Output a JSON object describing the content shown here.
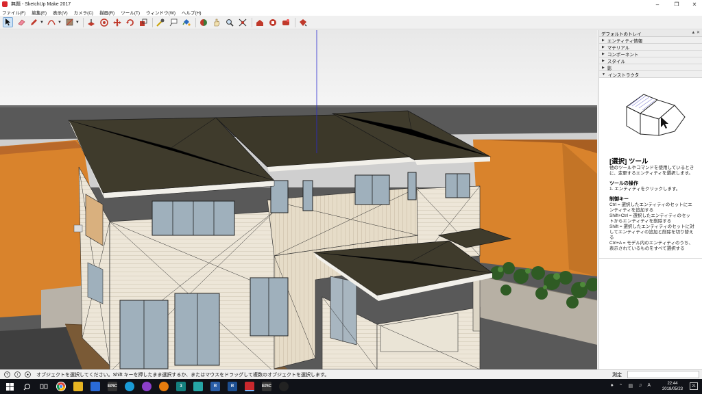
{
  "window": {
    "title": "無題 - SketchUp Make 2017"
  },
  "menu": [
    "ファイル(F)",
    "編集(E)",
    "表示(V)",
    "カメラ(C)",
    "描画(R)",
    "ツール(T)",
    "ウィンドウ(W)",
    "ヘルプ(H)"
  ],
  "tray": {
    "title": "デフォルトのトレイ",
    "panels": [
      "エンティティ情報",
      "マテリアル",
      "コンポーネント",
      "スタイル",
      "影",
      "インストラクタ"
    ],
    "instructor": {
      "tool_title": "[選択] ツール",
      "intro": "他のツールやコマンドを使用しているときに、変更するエンティティを選択します。",
      "ops_heading": "ツールの操作",
      "ops_step": "1. エンティティをクリックします。",
      "mod_heading": "制御キー",
      "mods": [
        "Ctrl = 選択したエンティティのセットにエンティティを追加する",
        "Shift+Ctrl = 選択したエンティティのセットからエンティティを削除する",
        "Shift = 選択したエンティティのセットに対してエンティティの追加と削除を切り替える",
        "Ctrl+A = モデル内のエンティティのうち、表示されているものをすべて選択する"
      ]
    }
  },
  "status": {
    "message": "オブジェクトを選択してください。Shift キーを押したまま選択するか、またはマウスをドラッグして複数のオブジェクトを選択します。",
    "measure_label": "測定",
    "measure_value": ""
  },
  "taskbar": {
    "apps": [
      "windows",
      "search",
      "task-view",
      "chrome",
      "folder",
      "store",
      "epic",
      "app-blue",
      "vs",
      "blender",
      "3dsmax",
      "maya",
      "revit",
      "revit-2",
      "sketchup",
      "epic-2",
      "unreal"
    ],
    "labels": {
      "epic": "EPIC",
      "3dsmax": "3",
      "revit": "R",
      "revit2": "R",
      "epic2": "EPIC",
      "notif": "21"
    },
    "time": "22:44",
    "date": "2018/05/23",
    "ime": "A"
  },
  "colors": {
    "roof": "#3d3a2a",
    "wall": "#efeae0",
    "orange": "#d97f2a",
    "sky": "#e9e9e9",
    "ground": "#5c5c5c"
  }
}
